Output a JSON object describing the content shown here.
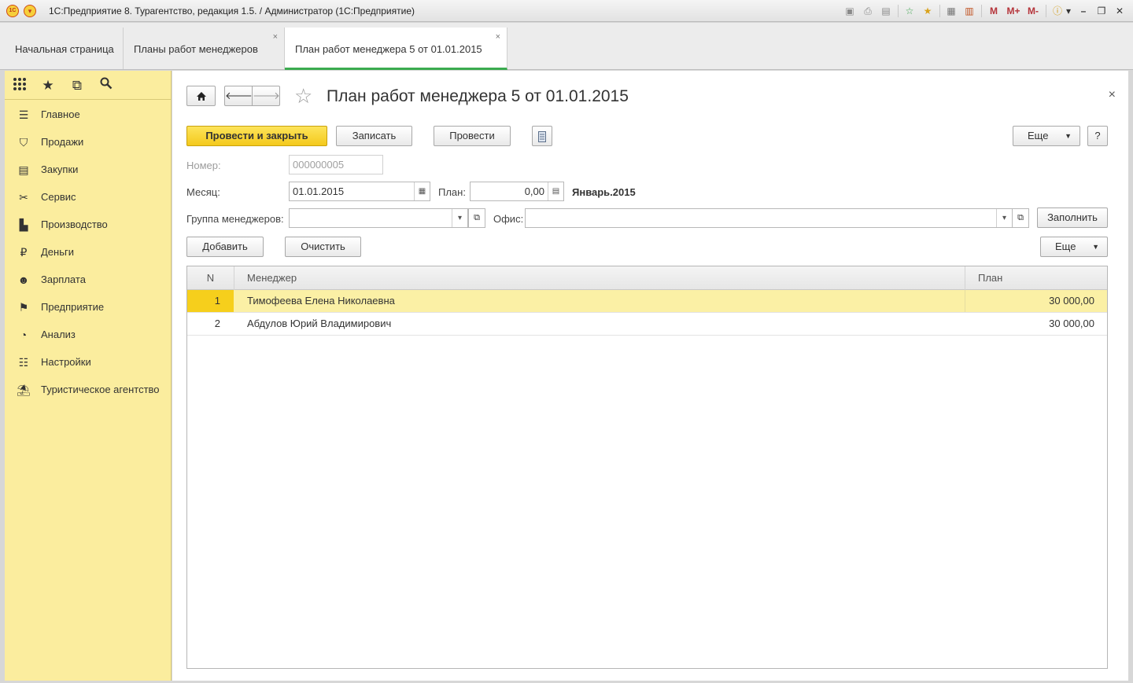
{
  "window": {
    "title": "1С:Предприятие 8. Турагентство, редакция 1.5. / Администратор  (1С:Предприятие)",
    "logo_text": "1С",
    "toolbar_icons": [
      "save-icon",
      "print-icon",
      "print-preview-icon",
      "favorites-add-icon",
      "favorites-icon",
      "calculator-icon",
      "calendar-icon",
      "memory-icon",
      "memory-plus-icon",
      "memory-minus-icon",
      "info-icon",
      "minimize-icon",
      "restore-icon",
      "close-icon"
    ],
    "memory_labels": [
      "M",
      "M+",
      "M-"
    ]
  },
  "tabs": [
    {
      "label": "Начальная страница"
    },
    {
      "label": "Планы работ менеджеров",
      "close": "×"
    },
    {
      "label": "План работ менеджера 5 от 01.01.2015",
      "close": "×"
    }
  ],
  "sidebar": {
    "top_icons": [
      "apps-grid-icon",
      "favorites-star-icon",
      "history-icon",
      "search-icon"
    ],
    "items": [
      {
        "label": "Главное",
        "icon": "menu-lines-icon"
      },
      {
        "label": "Продажи",
        "icon": "basket-icon"
      },
      {
        "label": "Закупки",
        "icon": "cart-icon"
      },
      {
        "label": "Сервис",
        "icon": "tools-icon"
      },
      {
        "label": "Производство",
        "icon": "factory-icon"
      },
      {
        "label": "Деньги",
        "icon": "ruble-coin-icon"
      },
      {
        "label": "Зарплата",
        "icon": "people-icon"
      },
      {
        "label": "Предприятие",
        "icon": "flag-icon"
      },
      {
        "label": "Анализ",
        "icon": "pie-chart-icon"
      },
      {
        "label": "Настройки",
        "icon": "settings-list-icon"
      },
      {
        "label": "Туристическое агентство",
        "icon": "palm-tree-icon"
      }
    ]
  },
  "document": {
    "title": "План работ менеджера 5 от 01.01.2015",
    "close": "×",
    "buttons": {
      "post_and_close": "Провести и закрыть",
      "save": "Записать",
      "post": "Провести",
      "more": "Еще",
      "help": "?"
    },
    "fields": {
      "number_label": "Номер:",
      "number_value": "000000005",
      "month_label": "Месяц:",
      "month_value": "01.01.2015",
      "plan_label": "План:",
      "plan_value": "0,00",
      "period_text": "Январь.2015",
      "group_label": "Группа менеджеров:",
      "group_value": "",
      "office_label": "Офис:",
      "office_value": ""
    },
    "fill_button": "Заполнить",
    "table_buttons": {
      "add": "Добавить",
      "clear": "Очистить",
      "more": "Еще"
    },
    "table": {
      "columns": [
        "N",
        "Менеджер",
        "План"
      ],
      "rows": [
        {
          "n": "1",
          "manager": "Тимофеева Елена Николаевна",
          "plan": "30 000,00",
          "selected": true
        },
        {
          "n": "2",
          "manager": "Абдулов Юрий Владимирович",
          "plan": "30 000,00",
          "selected": false
        }
      ]
    }
  }
}
